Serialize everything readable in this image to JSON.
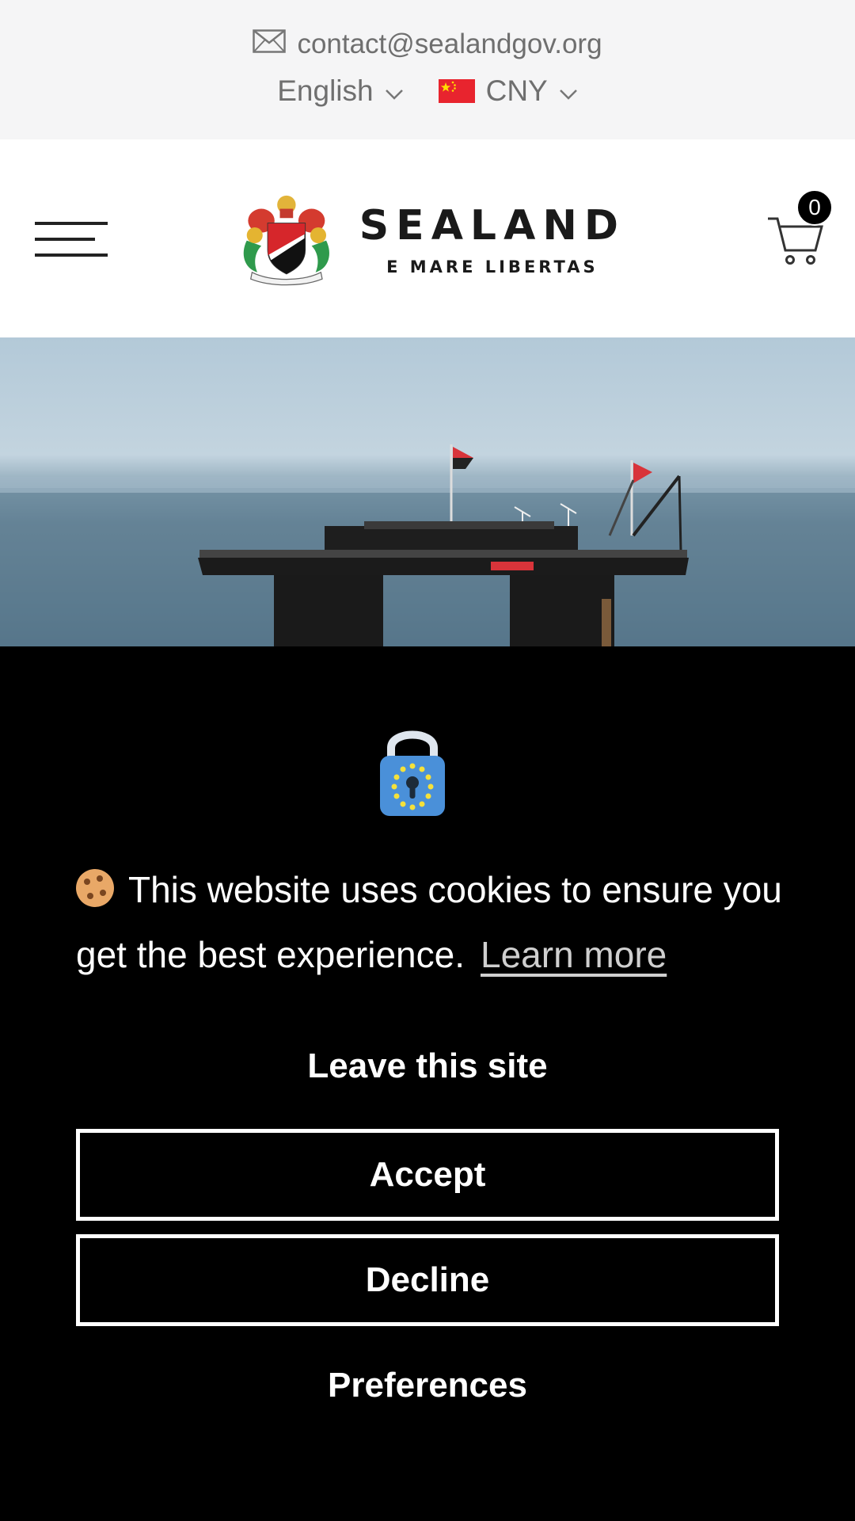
{
  "topbar": {
    "email": "contact@sealandgov.org",
    "language": "English",
    "currency": "CNY",
    "icons": {
      "email": "envelope-icon",
      "dropdown": "chevron-down-icon",
      "currency_flag": "china-flag-icon"
    }
  },
  "header": {
    "logo": {
      "title": "SEALAND",
      "motto": "E MARE LIBERTAS",
      "icon": "coat-of-arms-icon"
    },
    "menu_icon": "hamburger-menu-icon",
    "cart": {
      "icon": "cart-icon",
      "count": "0"
    }
  },
  "hero": {
    "description": "Sealand platform at sea photo"
  },
  "cookie_banner": {
    "icon": "padlock-icon",
    "message": "This website uses cookies to ensure you get the best experience.",
    "learn_more": "Learn more",
    "leave_site": "Leave this site",
    "accept": "Accept",
    "decline": "Decline",
    "preferences": "Preferences",
    "colors": {
      "background": "#000000",
      "text": "#ffffff",
      "lock": "#4a90d9",
      "stars": "#f5e13b"
    }
  }
}
